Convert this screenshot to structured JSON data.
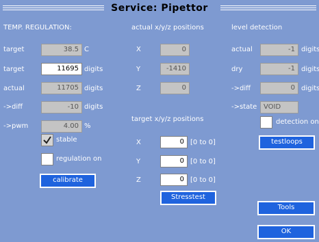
{
  "title": "Service: Pipettor",
  "temp": {
    "heading": "TEMP. REGULATION:",
    "rows": [
      {
        "label": "target",
        "value": "38.5",
        "unit": "C"
      },
      {
        "label": "target",
        "value": "11695",
        "unit": "digits"
      },
      {
        "label": "actual",
        "value": "11705",
        "unit": "digits"
      },
      {
        "label": "->diff",
        "value": "-10",
        "unit": "digits"
      },
      {
        "label": "->pwm",
        "value": "4.00",
        "unit": "%"
      }
    ],
    "stable_label": "stable",
    "stable_checked": true,
    "regulation_label": "regulation on",
    "regulation_checked": false,
    "calibrate_button": "calibrate"
  },
  "actual_positions": {
    "heading": "actual  x/y/z  positions",
    "rows": [
      {
        "axis": "X",
        "value": "0"
      },
      {
        "axis": "Y",
        "value": "-1410"
      },
      {
        "axis": "Z",
        "value": "0"
      }
    ]
  },
  "target_positions": {
    "heading": "target  x/y/z  positions",
    "rows": [
      {
        "axis": "X",
        "value": "0",
        "range": "[0  to  0]"
      },
      {
        "axis": "Y",
        "value": "0",
        "range": "[0  to  0]"
      },
      {
        "axis": "Z",
        "value": "0",
        "range": "[0  to  0]"
      }
    ],
    "stresstest_button": "Stresstest"
  },
  "level": {
    "heading": "level  detection",
    "rows": [
      {
        "label": "actual",
        "value": "-1",
        "unit": "digits"
      },
      {
        "label": "dry",
        "value": "-1",
        "unit": "digits"
      },
      {
        "label": "->diff",
        "value": "0",
        "unit": "digits"
      }
    ],
    "state_label": "->state",
    "state_value": "VOID",
    "detection_label": "detection  on",
    "detection_checked": false,
    "testloops_button": "testloops"
  },
  "buttons": {
    "tools": "Tools",
    "ok": "OK"
  }
}
